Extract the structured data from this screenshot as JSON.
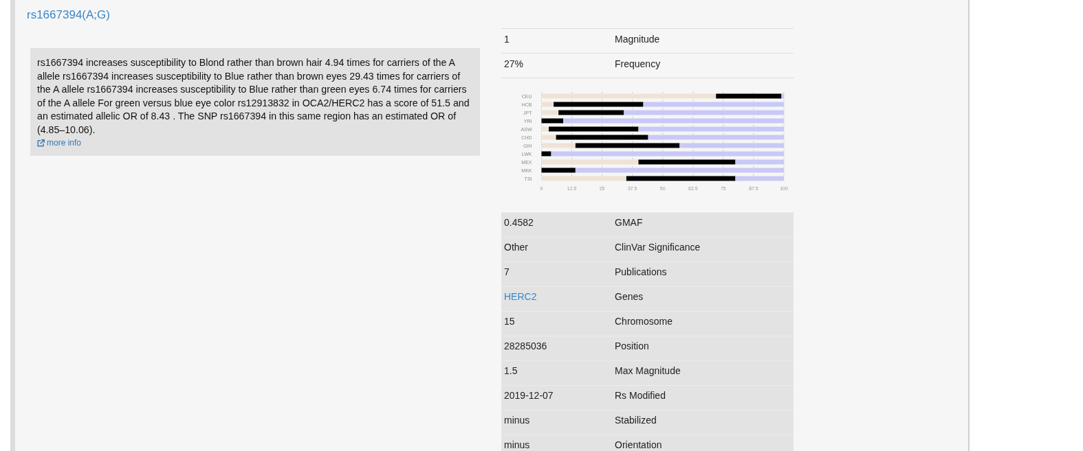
{
  "title": "rs1667394(A;G)",
  "summary": {
    "text": "rs1667394 increases susceptibility to Blond rather than brown hair 4.94 times for carriers of the A allele rs1667394 increases susceptibility to Blue rather than brown eyes 29.43 times for carriers of the A allele rs1667394 increases susceptibility to Blue rather than green eyes 6.74 times for carriers of the A allele For green versus blue eye color rs12913832 in OCA2/HERC2 has a score of 51.5 and an estimated allelic OR of 8.43 . The SNP rs1667394 in this same region has an estimated OR of (4.85–10.06).",
    "link": "more info"
  },
  "top_table": [
    {
      "value": "1",
      "label": "Magnitude"
    },
    {
      "value": "27%",
      "label": "Frequency"
    }
  ],
  "population_chart": {
    "chart_data": {
      "type": "bar",
      "orientation": "horizontal",
      "stacked": true,
      "grid": true,
      "categories": [
        "CEU",
        "HCB",
        "JPT",
        "YRI",
        "ASW",
        "CHD",
        "GIH",
        "LWK",
        "MEX",
        "MKK",
        "TSI"
      ],
      "series": [
        {
          "color": "#efe3d6",
          "values": [
            72,
            5,
            7,
            0,
            3,
            6,
            14,
            0,
            40,
            0,
            35
          ]
        },
        {
          "color": "#000000",
          "values": [
            27,
            37,
            27,
            9,
            37,
            38,
            43,
            4,
            40,
            14,
            45
          ]
        },
        {
          "color": "#c9c9f7",
          "values": [
            1,
            58,
            66,
            91,
            60,
            56,
            43,
            96,
            20,
            86,
            20
          ]
        }
      ],
      "xlim": [
        0,
        100
      ],
      "xticks": [
        0,
        12.5,
        25,
        37.5,
        50,
        62.5,
        75,
        87.5,
        100
      ]
    }
  },
  "details_table": [
    {
      "kind": "text",
      "value": "0.4582",
      "label": "GMAF"
    },
    {
      "kind": "text",
      "value": "Other",
      "label": "ClinVar Significance"
    },
    {
      "kind": "text",
      "value": "7",
      "label": "Publications"
    },
    {
      "kind": "link",
      "value": "HERC2",
      "label": "Genes"
    },
    {
      "kind": "text",
      "value": "15",
      "label": "Chromosome"
    },
    {
      "kind": "text",
      "value": "28285036",
      "label": "Position"
    },
    {
      "kind": "text",
      "value": "1.5",
      "label": "Max Magnitude"
    },
    {
      "kind": "text",
      "value": "2019-12-07",
      "label": "Rs Modified"
    },
    {
      "kind": "text",
      "value": "minus",
      "label": "Stabilized"
    },
    {
      "kind": "text",
      "value": "minus",
      "label": "Orientation"
    }
  ]
}
